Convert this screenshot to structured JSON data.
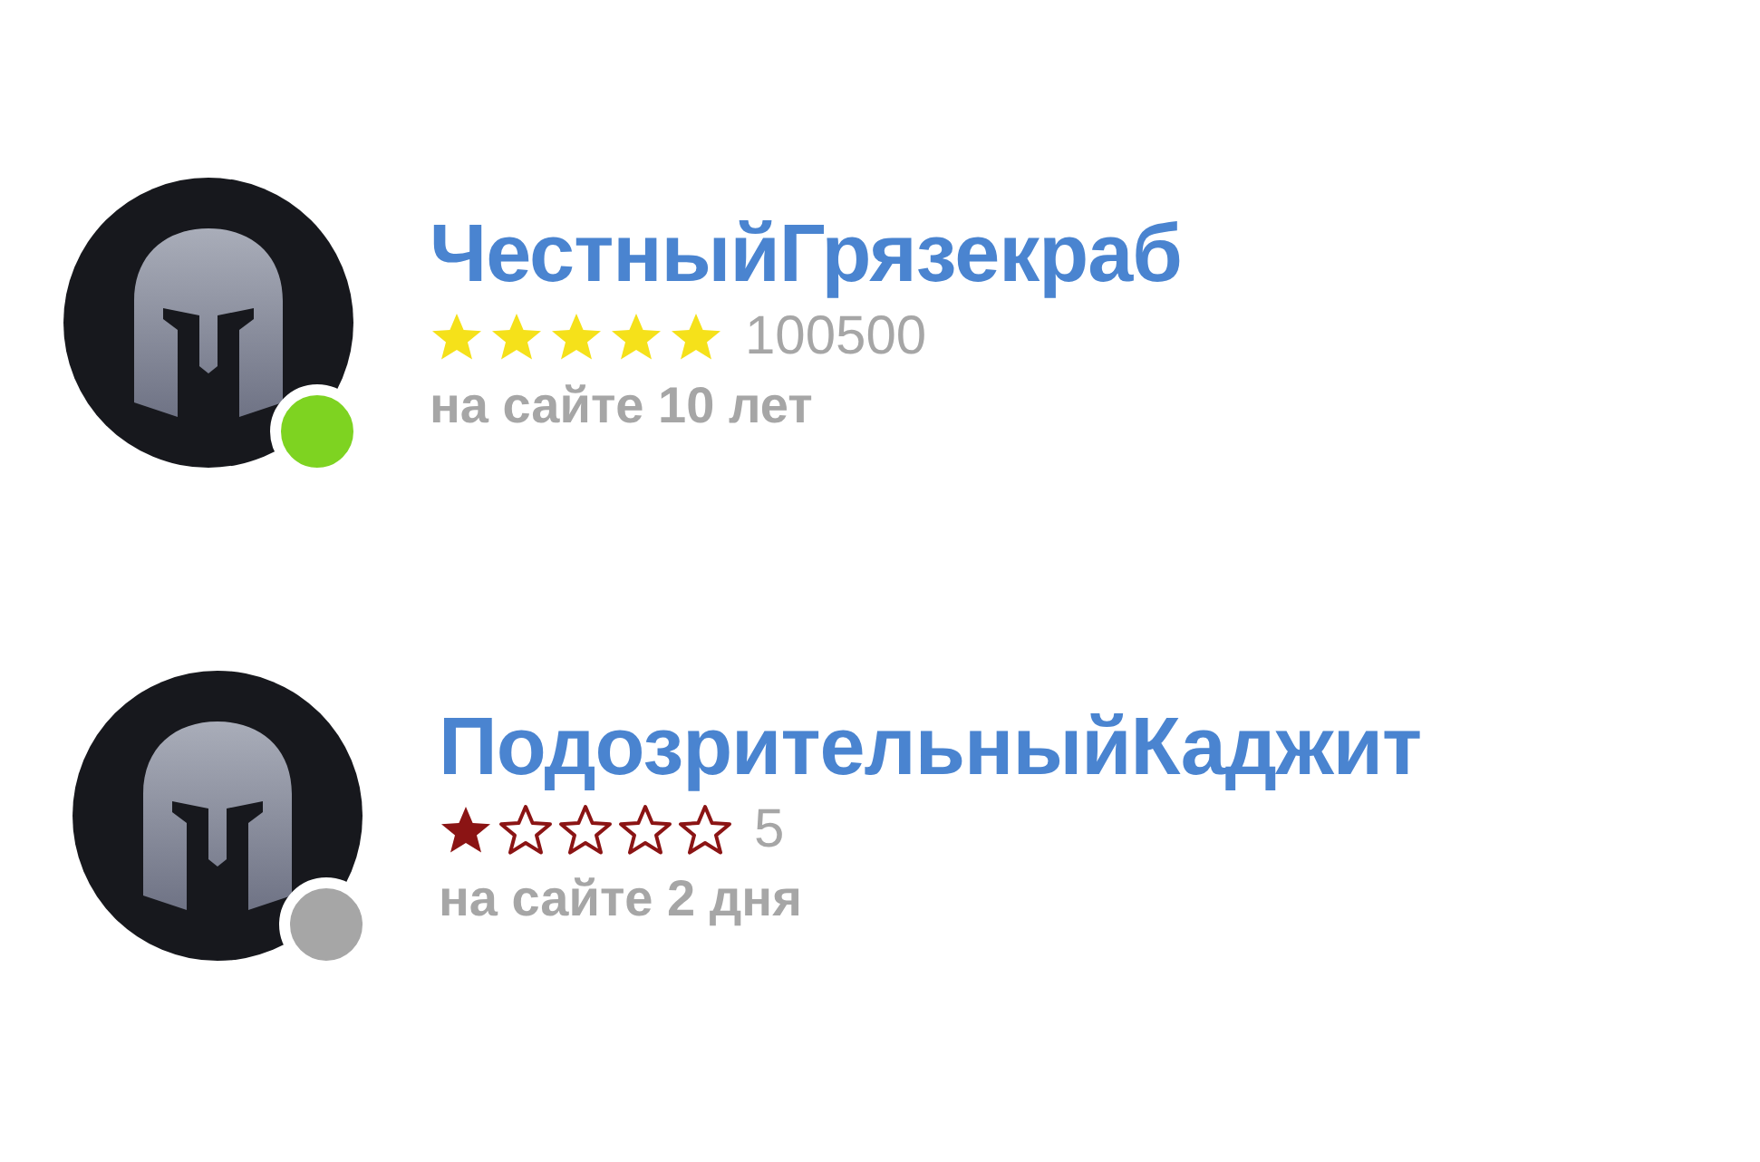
{
  "users": [
    {
      "name": "ЧестныйГрязекраб",
      "stars": 5,
      "color": "#f5e11a",
      "rating": "100500",
      "since": "на сайте 10 лет",
      "online": true
    },
    {
      "name": "ПодозрительныйКаджит",
      "stars": 1,
      "color": "#8b1414",
      "rating": "5",
      "since": "на сайте 2 дня",
      "online": false
    }
  ]
}
